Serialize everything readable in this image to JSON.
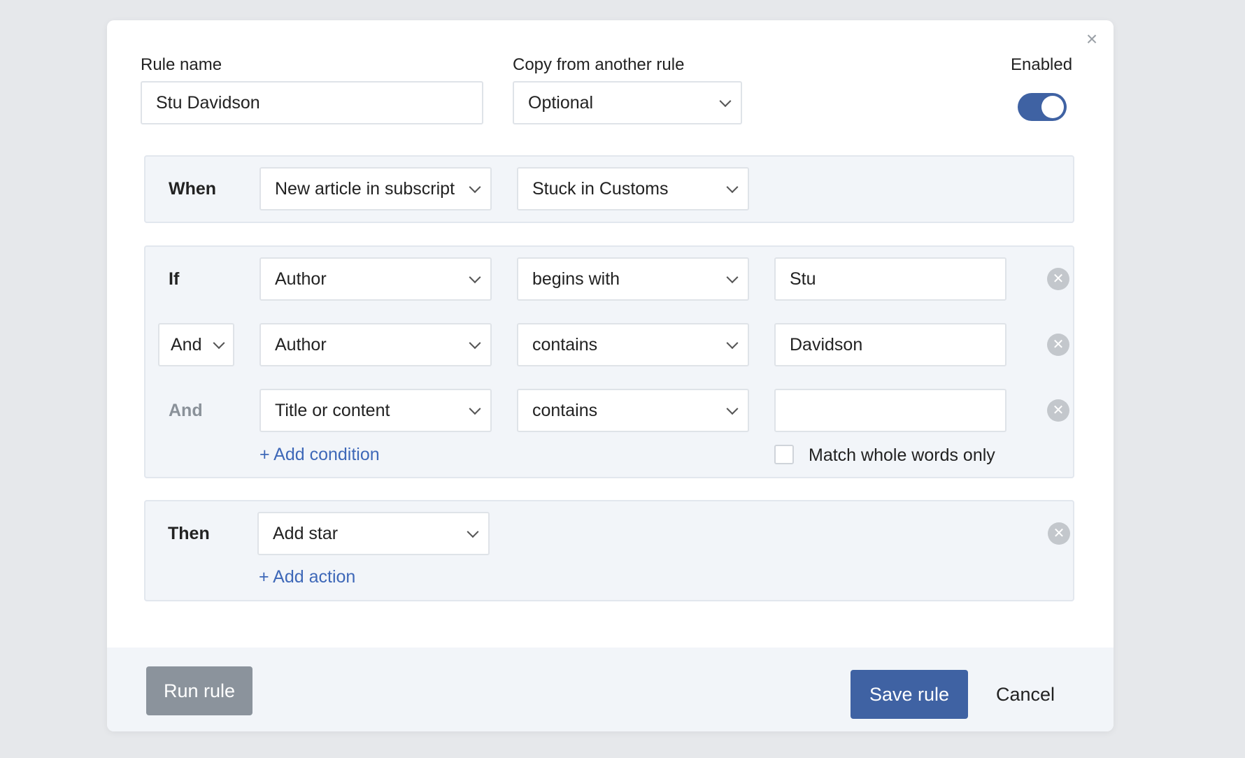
{
  "dialog": {
    "close_glyph": "×",
    "rule_name_label": "Rule name",
    "rule_name_value": "Stu Davidson",
    "copy_label": "Copy from another rule",
    "copy_value": "Optional",
    "enabled_label": "Enabled",
    "enabled": true
  },
  "when": {
    "label": "When",
    "trigger": "New article in subscript",
    "target": "Stuck in Customs"
  },
  "conditions": {
    "label_first": "If",
    "label_and": "And",
    "rows": [
      {
        "field": "Author",
        "operator": "begins with",
        "value": "Stu"
      },
      {
        "connector": "And",
        "field": "Author",
        "operator": "contains",
        "value": "Davidson"
      },
      {
        "connector": "And",
        "field": "Title or content",
        "operator": "contains",
        "value": ""
      }
    ],
    "add_condition": "+ Add condition",
    "match_whole_words": "Match whole words only",
    "match_whole_words_checked": false
  },
  "then": {
    "label": "Then",
    "action": "Add star",
    "add_action": "+ Add action"
  },
  "footer": {
    "run_rule": "Run rule",
    "save_rule": "Save rule",
    "cancel": "Cancel"
  },
  "colors": {
    "primary": "#3f62a3",
    "link": "#3e68b8",
    "disabled_button": "#8b939c",
    "section_bg": "#f2f5f9"
  }
}
